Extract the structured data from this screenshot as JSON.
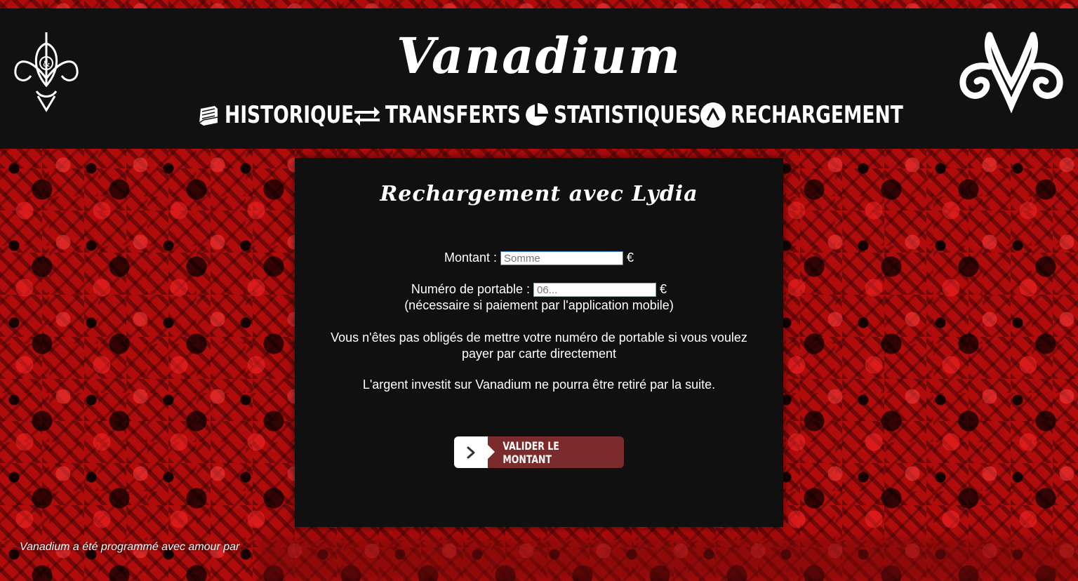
{
  "header": {
    "title": "Vanadium",
    "nav": [
      {
        "label": "HISTORIQUE",
        "icon": "book-icon"
      },
      {
        "label": "TRANSFERTS",
        "icon": "exchange-icon"
      },
      {
        "label": "STATISTIQUES",
        "icon": "pie-chart-icon"
      },
      {
        "label": "RECHARGEMENT",
        "icon": "lydia-icon"
      }
    ],
    "logo_left": "ampersand-ornament-logo",
    "logo_right": "vw-monogram-logo"
  },
  "panel": {
    "title": "Rechargement avec Lydia",
    "amount_label": "Montant :",
    "amount_placeholder": "Somme",
    "amount_currency": "€",
    "phone_label": "Numéro de portable :",
    "phone_placeholder": "06...",
    "phone_currency": "€",
    "phone_note": "(nécessaire si paiement par l'application mobile)",
    "info_line_1": "Vous n'êtes pas obligés de mettre votre numéro de portable si vous voulez",
    "info_line_2": "payer par carte directement",
    "warning": "L'argent investit sur Vanadium ne pourra être retiré par la suite.",
    "submit_label": "VALIDER LE MONTANT"
  },
  "footer": {
    "credit": "Vanadium a été programmé avec amour par"
  },
  "colors": {
    "header_bg": "#111111",
    "panel_bg": "#101010",
    "button_accent": "#7b2b2b",
    "background_red": "#b00c0c"
  }
}
